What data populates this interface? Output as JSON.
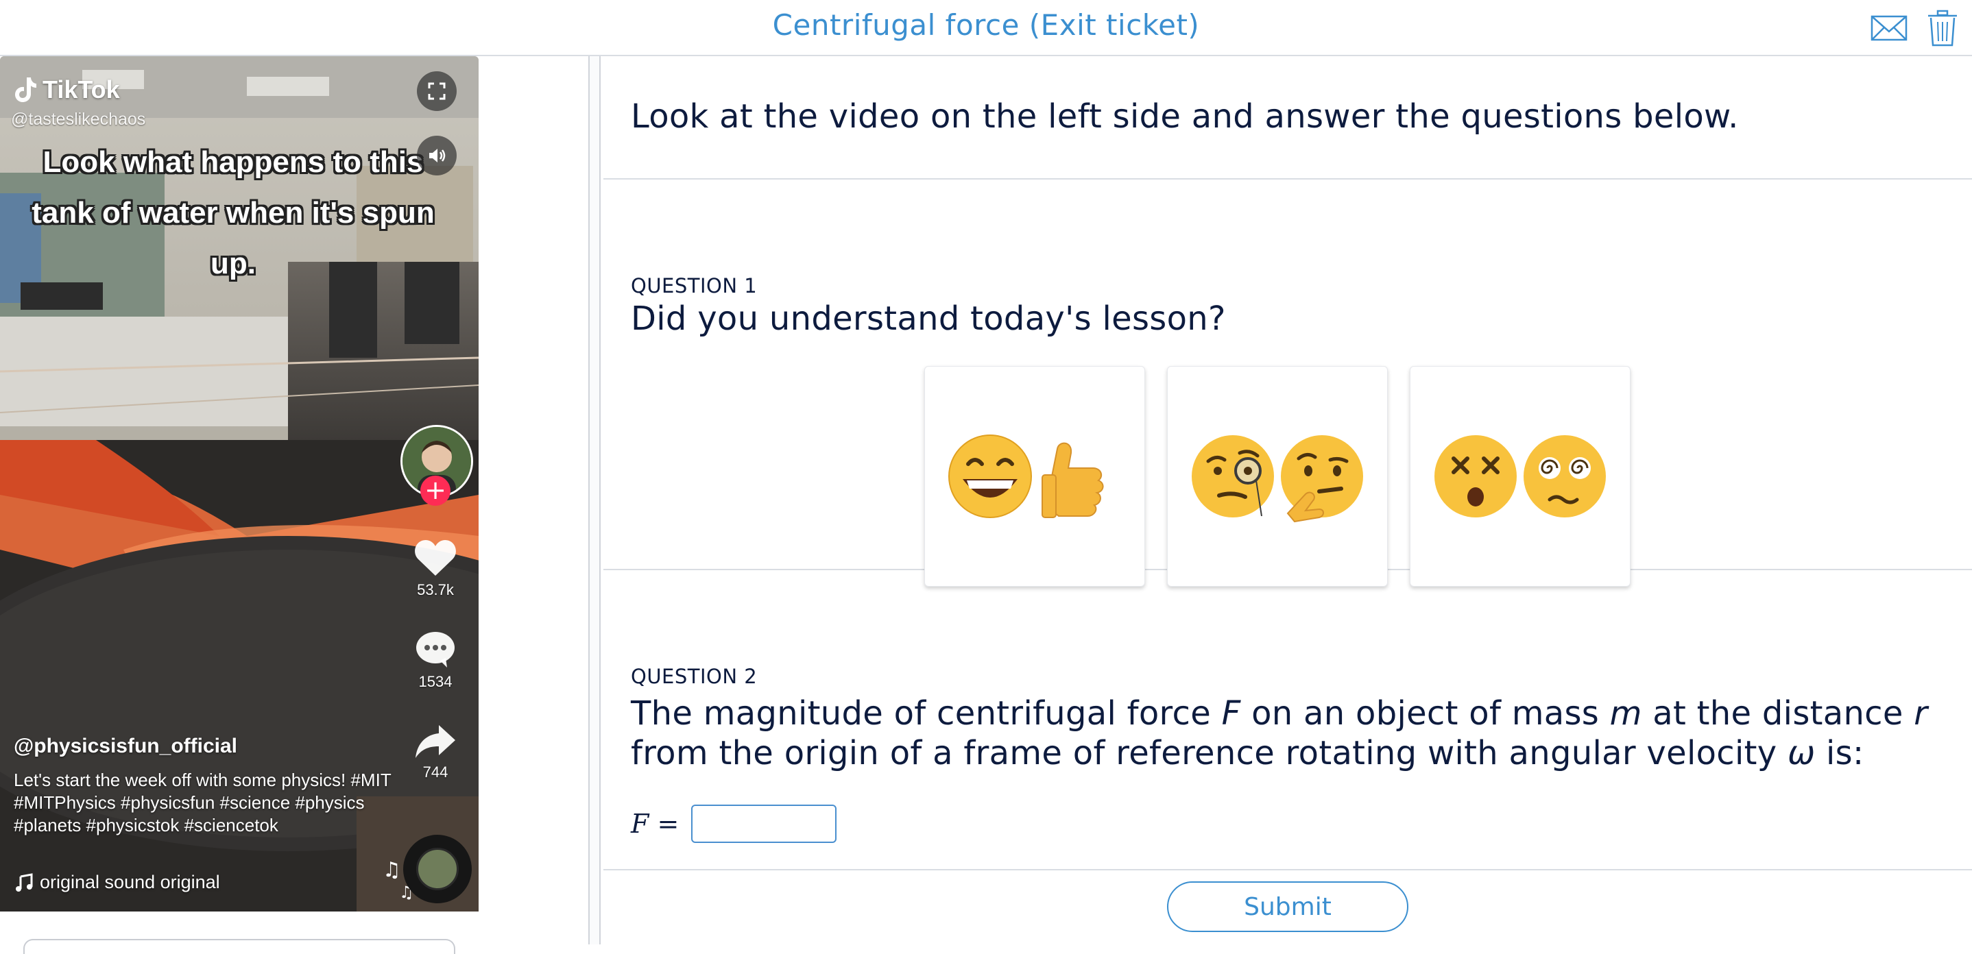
{
  "header": {
    "title": "Centrifugal force (Exit ticket)",
    "mail_icon": "envelope-icon",
    "trash_icon": "trash-icon"
  },
  "video": {
    "brand": "TikTok",
    "handle": "@tasteslikechaos",
    "caption": "Look what happens to this tank of water when it's spun up.",
    "likes": "53.7k",
    "comments": "1534",
    "shares": "744",
    "author": "@physicsisfun_official",
    "description": "Let's start the week off with some physics! #MIT #MITPhysics #physicsfun #science #physics #planets #physicstok #sciencetok",
    "music": "original sound  original",
    "icons": [
      "expand-icon",
      "sound-icon",
      "heart-icon",
      "comment-icon",
      "share-icon",
      "music-note-icon"
    ]
  },
  "intro": {
    "text": "Look at the video on the left side and answer the questions below."
  },
  "question1": {
    "label": "QUESTION 1",
    "text": "Did you understand today's lesson?",
    "options": [
      {
        "id": "understood",
        "emojis": [
          "grinning-face",
          "thumbs-up"
        ]
      },
      {
        "id": "unsure",
        "emojis": [
          "face-with-monocle",
          "thinking-face"
        ]
      },
      {
        "id": "confused",
        "emojis": [
          "dizzy-face",
          "face-with-spiral-eyes"
        ]
      }
    ]
  },
  "question2": {
    "label": "QUESTION 2",
    "text_parts": {
      "p1": "The magnitude of centrifugal force ",
      "F": "F",
      "p2": " on an object of mass ",
      "m": "m",
      "p3": " at the distance ",
      "r": "r",
      "p4": "from the origin of a frame of reference rotating with angular velocity ",
      "omega": "ω",
      "p5": " is:"
    },
    "answer_prefix": "F =",
    "answer_value": ""
  },
  "submit_label": "Submit"
}
